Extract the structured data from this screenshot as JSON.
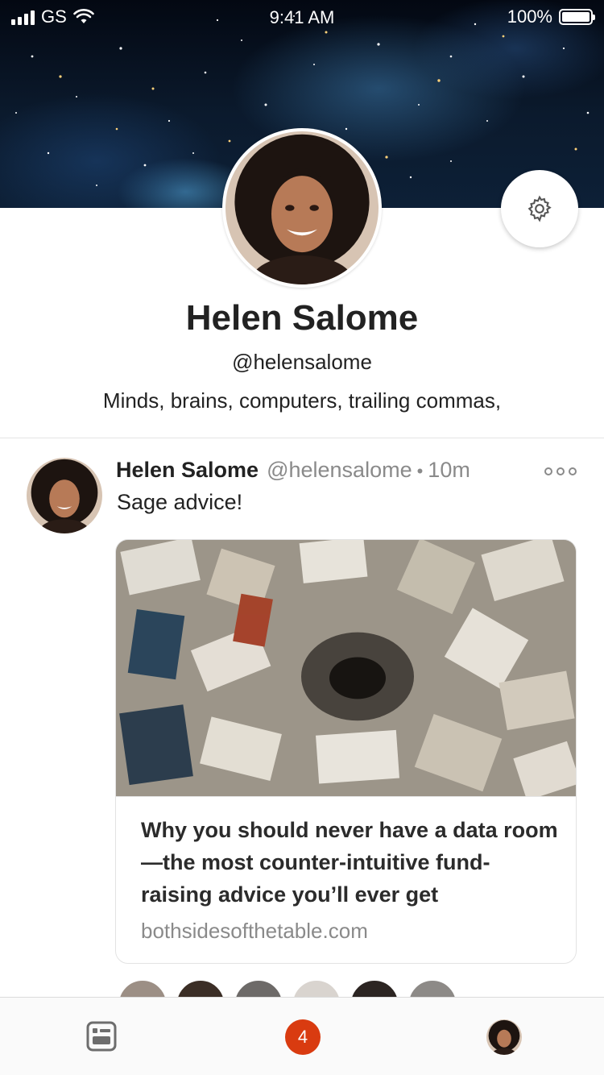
{
  "status_bar": {
    "carrier": "GS",
    "time": "9:41 AM",
    "battery": "100%",
    "battery_level": 1.0,
    "icons": [
      "signal-icon",
      "wifi-icon",
      "battery-icon"
    ]
  },
  "profile": {
    "name": "Helen Salome",
    "handle": "@helensalome",
    "bio": "Minds, brains, computers, trailing commas,"
  },
  "settings": {
    "icon": "gear-icon"
  },
  "post": {
    "author": "Helen Salome",
    "handle": "@helensalome",
    "separator": "•",
    "time": "10m",
    "text": "Sage advice!",
    "more_icon": "more-dots-icon",
    "link": {
      "title": "Why you should never have a data room—the most counter-intuitive fund-raising advice you’ll ever get",
      "domain": "bothsidesofthetable.com"
    }
  },
  "tab_bar": {
    "feed_icon": "feed-icon",
    "notifications_count": "4",
    "profile_icon": "avatar"
  },
  "colors": {
    "badge": "#d93b10",
    "muted_text": "#8a8a8a",
    "primary_text": "#222222",
    "divider": "#e4e4e4"
  }
}
